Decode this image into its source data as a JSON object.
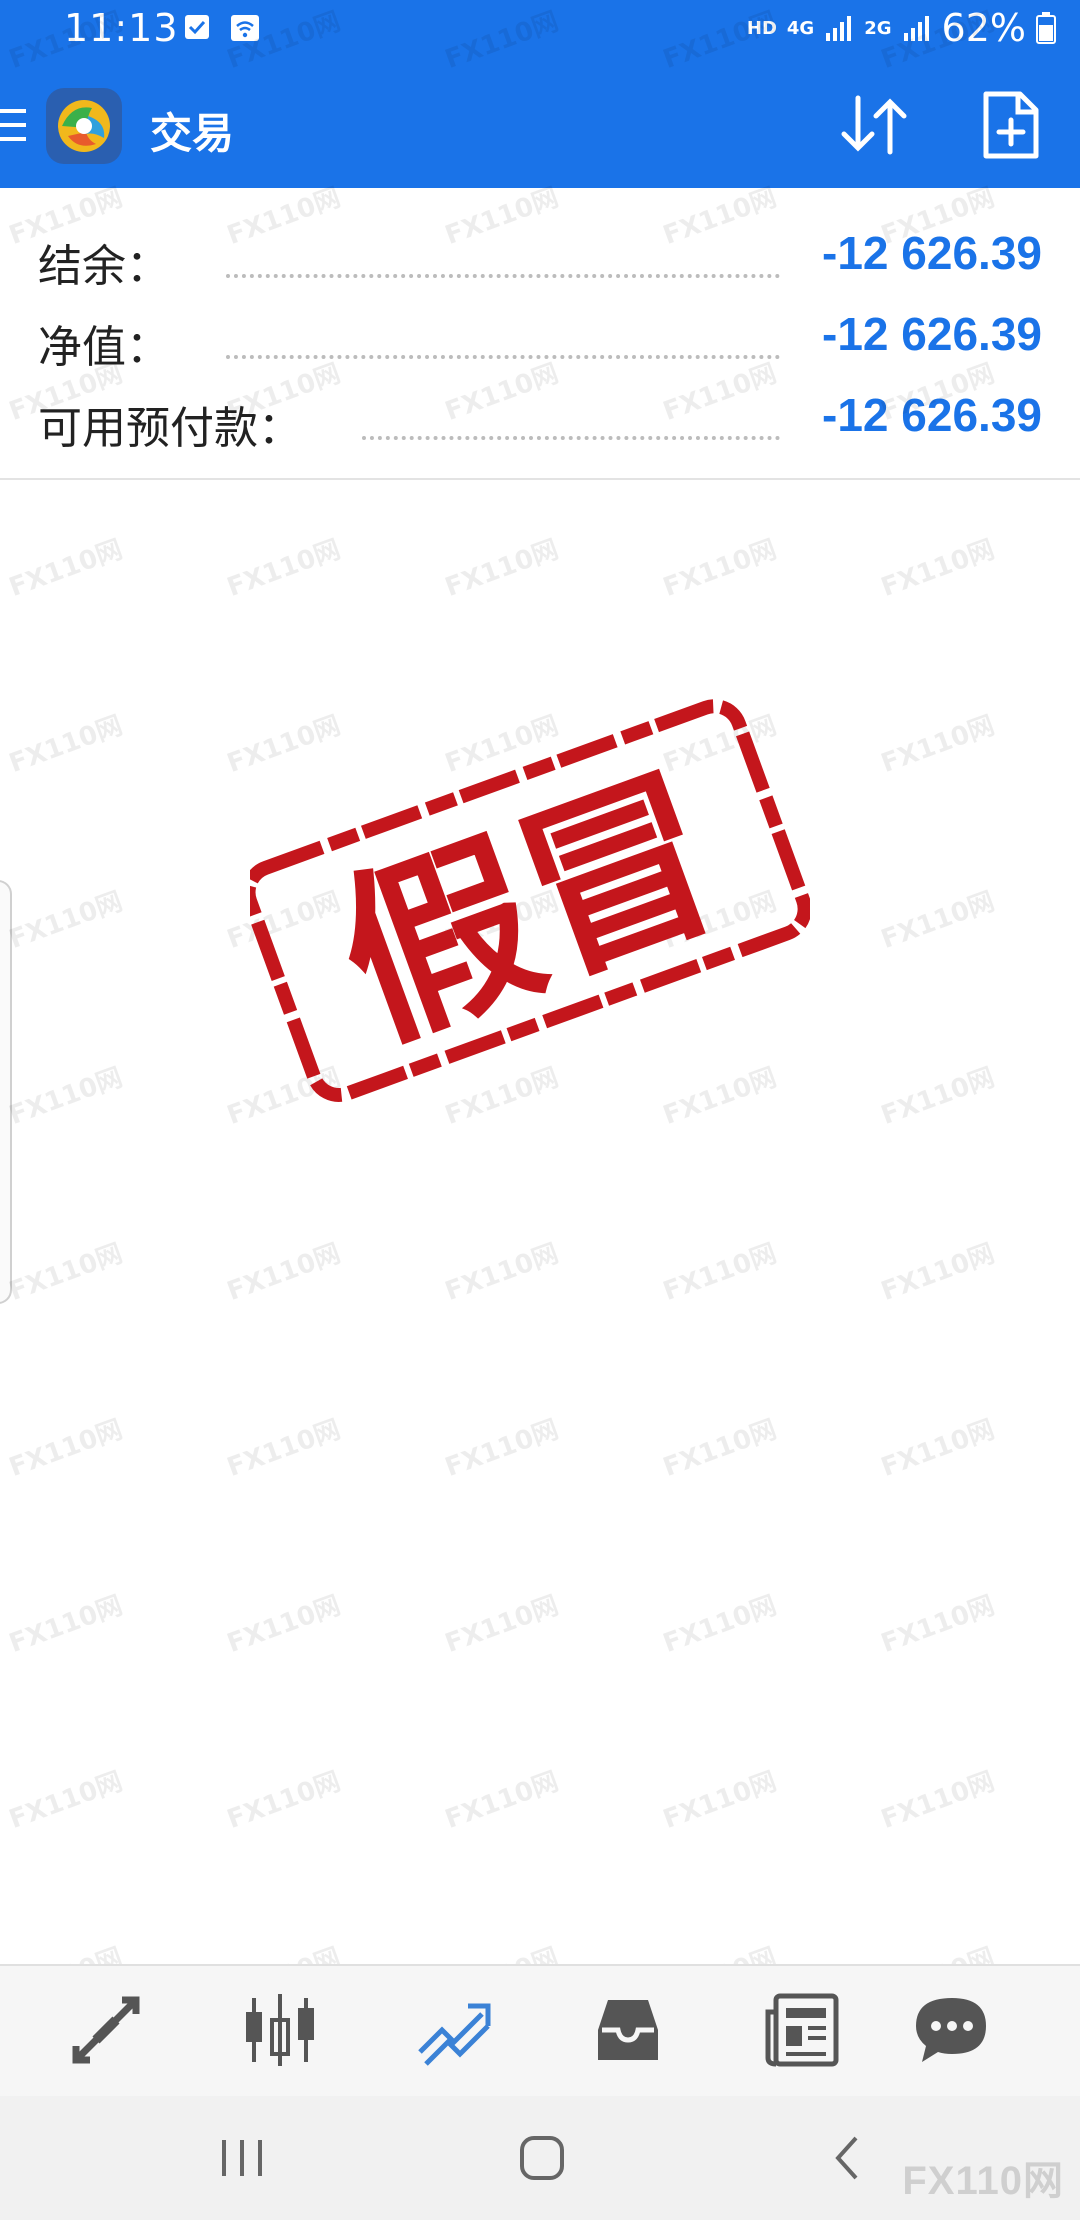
{
  "status_bar": {
    "time": "11:13",
    "hd": "HD",
    "net1": "4G",
    "net2": "2G",
    "battery": "62%"
  },
  "app_bar": {
    "title": "交易",
    "icons": [
      "menu-icon",
      "app-logo-icon",
      "sort-icon",
      "new-order-icon"
    ]
  },
  "summary": {
    "rows": [
      {
        "label": "结余：",
        "value": "-12 626.39"
      },
      {
        "label": "净值：",
        "value": "-12 626.39"
      },
      {
        "label": "可用预付款：",
        "value": "-12 626.39"
      }
    ]
  },
  "overlay": {
    "stamp_text": "假冒",
    "watermark_text": "FX110网",
    "corner_watermark": "FX110网"
  },
  "bottom_nav": {
    "items": [
      "quotes-icon",
      "chart-icon",
      "trade-icon",
      "history-icon",
      "news-icon",
      "chat-icon"
    ],
    "active": "trade-icon"
  },
  "colors": {
    "accent": "#1a73e8",
    "stamp": "#c4161c",
    "nav_icon": "#555555"
  }
}
